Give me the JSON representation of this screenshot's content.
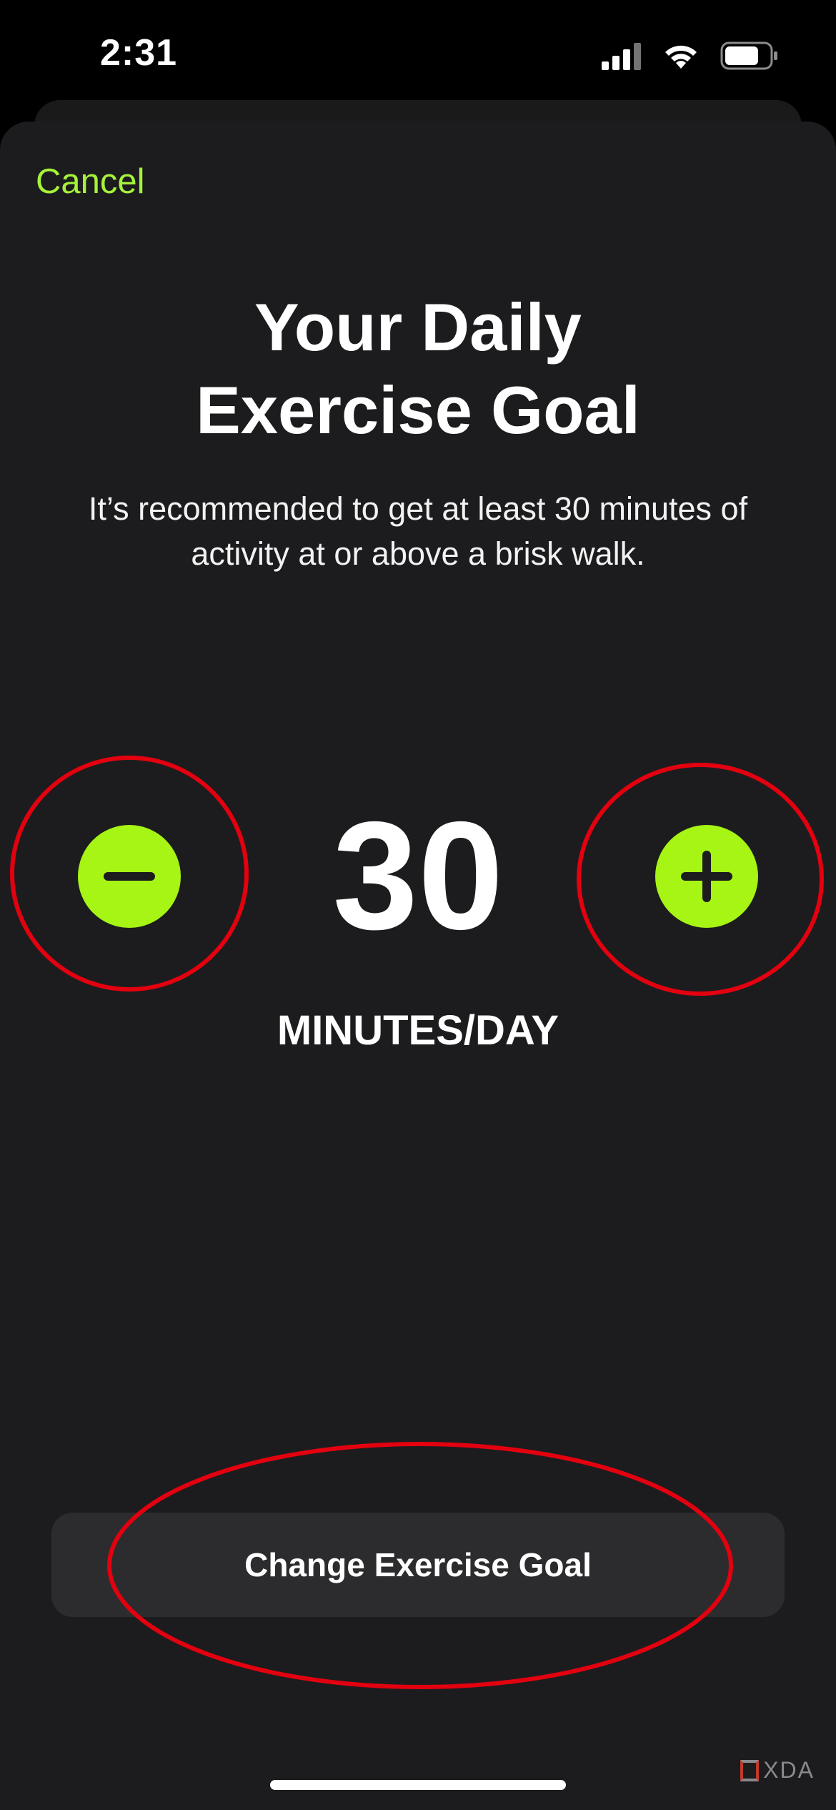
{
  "status_bar": {
    "time": "2:31",
    "signal_icon": "cellular-signal-icon",
    "wifi_icon": "wifi-icon",
    "battery_icon": "battery-icon"
  },
  "sheet": {
    "cancel_label": "Cancel",
    "title_line1": "Your Daily",
    "title_line2": "Exercise Goal",
    "description_line1": "It’s recommended to get at least 30 minutes of",
    "description_line2": "activity at or above a brisk walk."
  },
  "stepper": {
    "value": "30",
    "unit": "MINUTES/DAY",
    "decrease_icon": "minus-icon",
    "increase_icon": "plus-icon"
  },
  "primary_button": {
    "label": "Change Exercise Goal"
  },
  "watermark": {
    "text": "XDA"
  },
  "colors": {
    "accent": "#a6f514",
    "cancel_text": "#a6f23a",
    "sheet_background": "#1c1c1e",
    "button_background": "#2c2c2e",
    "annotation_red": "#e3000f"
  }
}
